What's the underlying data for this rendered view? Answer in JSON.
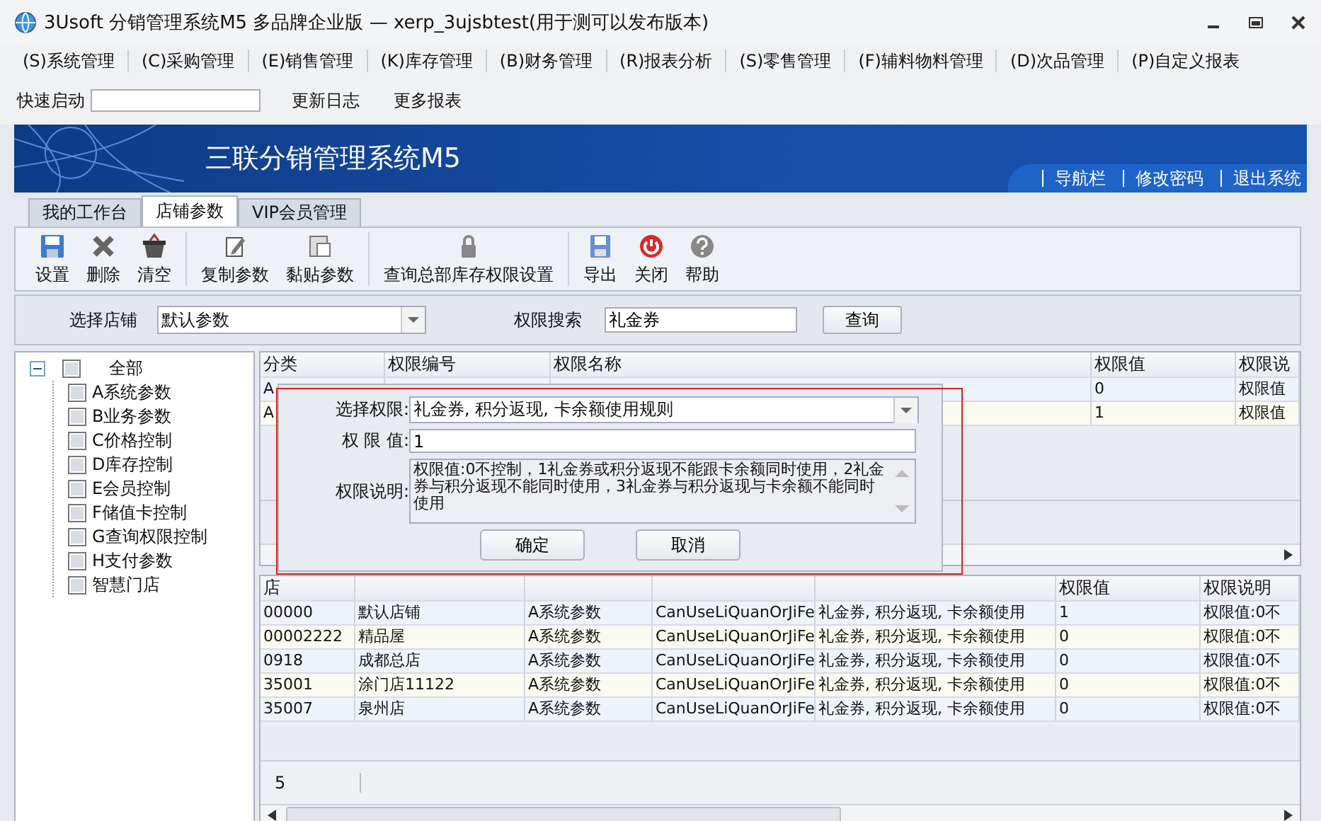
{
  "window": {
    "title": "3Usoft 分销管理系统M5 多品牌企业版 — xerp_3ujsbtest(用于测可以发布版本)"
  },
  "menu": [
    {
      "label": "(S)系统管理"
    },
    {
      "label": "(C)采购管理"
    },
    {
      "label": "(E)销售管理"
    },
    {
      "label": "(K)库存管理"
    },
    {
      "label": "(B)财务管理"
    },
    {
      "label": "(R)报表分析"
    },
    {
      "label": "(S)零售管理"
    },
    {
      "label": "(F)辅料物料管理"
    },
    {
      "label": "(D)次品管理"
    },
    {
      "label": "(P)自定义报表"
    }
  ],
  "quick_launch": {
    "label": "快速启动",
    "links": [
      "更新日志",
      "更多报表"
    ]
  },
  "banner": {
    "title": "三联分销管理系统M5",
    "links": [
      "导航栏",
      "修改密码",
      "退出系统"
    ]
  },
  "tabs": [
    {
      "label": "我的工作台",
      "selected": false
    },
    {
      "label": "店铺参数",
      "selected": true
    },
    {
      "label": "VIP会员管理",
      "selected": false
    }
  ],
  "toolbar": [
    [
      {
        "label": "设置",
        "kind": "save"
      },
      {
        "label": "删除",
        "kind": "delete"
      },
      {
        "label": "清空",
        "kind": "clear"
      }
    ],
    [
      {
        "label": "复制参数",
        "kind": "copy"
      },
      {
        "label": "黏贴参数",
        "kind": "paste"
      }
    ],
    [
      {
        "label": "查询总部库存权限设置",
        "kind": "lock"
      }
    ],
    [
      {
        "label": "导出",
        "kind": "export"
      },
      {
        "label": "关闭",
        "kind": "close"
      },
      {
        "label": "帮助",
        "kind": "help"
      }
    ]
  ],
  "filter": {
    "store_label": "选择店铺",
    "store_value": "默认参数",
    "search_label": "权限搜索",
    "search_value": "礼金券",
    "search_button": "查询"
  },
  "tree": {
    "label": "全部",
    "expanded": true,
    "checked": false,
    "children": [
      {
        "label": "A系统参数",
        "checked": false
      },
      {
        "label": "B业务参数",
        "checked": false
      },
      {
        "label": "C价格控制",
        "checked": false
      },
      {
        "label": "D库存控制",
        "checked": false
      },
      {
        "label": "E会员控制",
        "checked": false
      },
      {
        "label": "F储值卡控制",
        "checked": false
      },
      {
        "label": "G查询权限控制",
        "checked": false
      },
      {
        "label": "H支付参数",
        "checked": false
      },
      {
        "label": "智慧门店",
        "checked": false
      }
    ]
  },
  "upper_grid": {
    "columns": [
      {
        "label": "分类"
      },
      {
        "label": "权限编号"
      },
      {
        "label": "权限名称"
      },
      {
        "label": "权限值"
      },
      {
        "label": "权限说"
      }
    ],
    "rows": [
      {
        "cells": [
          "A",
          "",
          "",
          "0",
          "权限值"
        ]
      },
      {
        "cells": [
          "A",
          "",
          "",
          "1",
          "权限值"
        ]
      }
    ]
  },
  "dialog": {
    "permission_label": "选择权限:",
    "permission_value": "礼金券, 积分返现, 卡余额使用规则",
    "value_label": "权 限 值:",
    "value": "1",
    "description_label": "权限说明:",
    "description": "权限值:0不控制，1礼金券或积分返现不能跟卡余额同时使用，2礼金券与积分返现不能同时使用，3礼金券与积分返现与卡余额不能同时使用",
    "buttons": [
      "确定",
      "取消"
    ]
  },
  "lower_grid": {
    "columns": [
      {
        "label": "店"
      },
      {},
      {},
      {},
      {},
      {
        "label": "权限值"
      },
      {
        "label": "权限说明"
      }
    ],
    "rows": [
      {
        "cells": [
          "00000",
          "默认店铺",
          "A系统参数",
          "CanUseLiQuanOrJiFe",
          "礼金券, 积分返现, 卡余额使用",
          "1",
          "权限值:0不"
        ]
      },
      {
        "cells": [
          "00002222",
          "精品屋",
          "A系统参数",
          "CanUseLiQuanOrJiFe",
          "礼金券, 积分返现, 卡余额使用",
          "0",
          "权限值:0不"
        ]
      },
      {
        "cells": [
          "0918",
          "成都总店",
          "A系统参数",
          "CanUseLiQuanOrJiFe",
          "礼金券, 积分返现, 卡余额使用",
          "0",
          "权限值:0不"
        ]
      },
      {
        "cells": [
          "35001",
          "涂门店11122",
          "A系统参数",
          "CanUseLiQuanOrJiFe",
          "礼金券, 积分返现, 卡余额使用",
          "0",
          "权限值:0不"
        ]
      },
      {
        "cells": [
          "35007",
          "泉州店",
          "A系统参数",
          "CanUseLiQuanOrJiFe",
          "礼金券, 积分返现, 卡余额使用",
          "0",
          "权限值:0不"
        ]
      }
    ],
    "footer": "5"
  }
}
